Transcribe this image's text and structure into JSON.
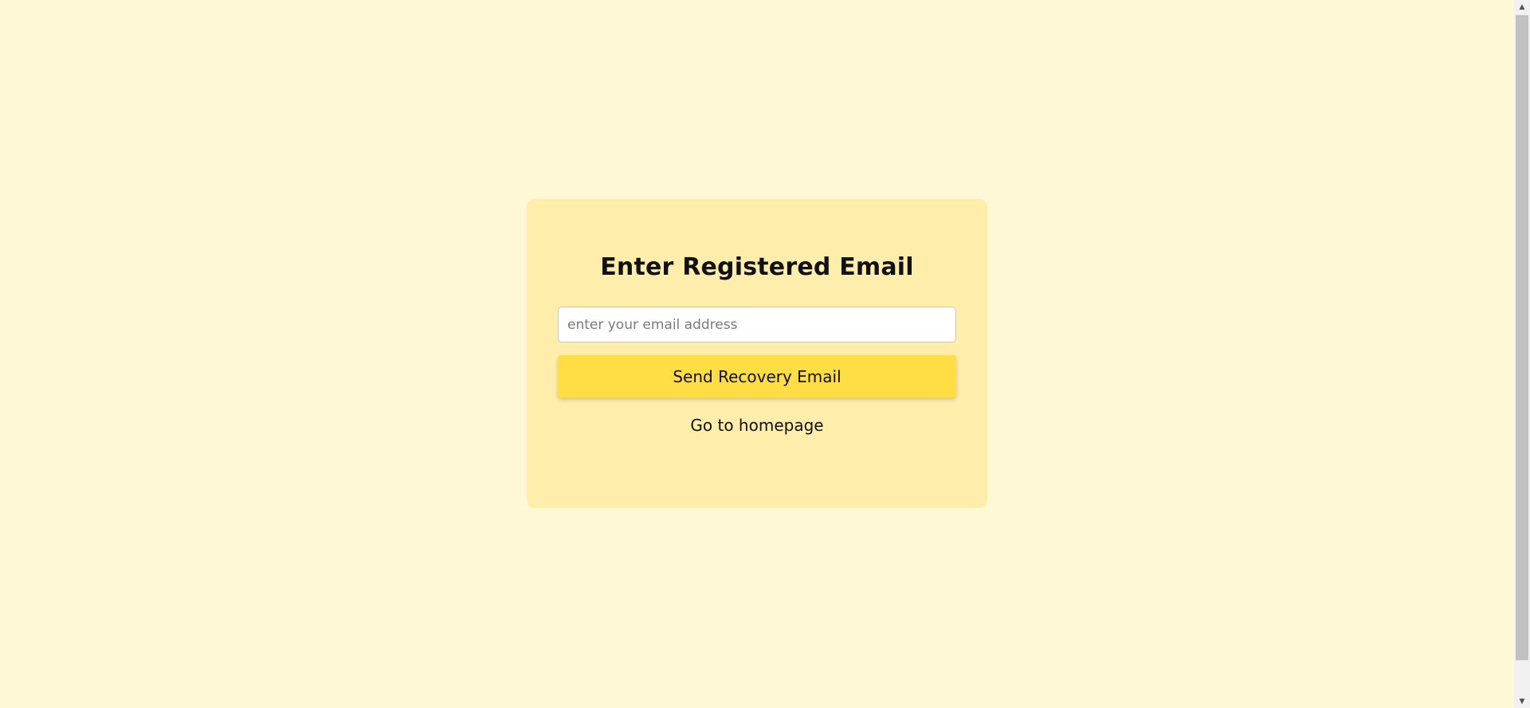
{
  "form": {
    "title": "Enter Registered Email",
    "email_placeholder": "enter your email address",
    "email_value": "",
    "send_button_label": "Send Recovery Email",
    "home_link_label": "Go to homepage"
  },
  "colors": {
    "page_background": "#fff8d6",
    "card_background": "#ffeeab",
    "button_background": "#ffdd44"
  },
  "scrollbar": {
    "up_icon": "chevron-up-icon",
    "down_icon": "chevron-down-icon"
  }
}
